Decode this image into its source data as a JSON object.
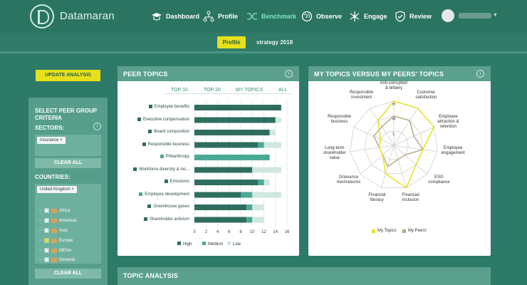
{
  "brand": "Datamaran",
  "nav": [
    {
      "label": "Dashboard",
      "icon": "mortarboard-icon"
    },
    {
      "label": "Profile",
      "icon": "network-icon"
    },
    {
      "label": "Benchmark",
      "icon": "shuffle-icon",
      "active": true
    },
    {
      "label": "Observe",
      "icon": "globe-icon"
    },
    {
      "label": "Engage",
      "icon": "asterisk-icon"
    },
    {
      "label": "Review",
      "icon": "shield-check-icon"
    }
  ],
  "subtabs": {
    "profile": "Profile",
    "strategy": "strategy 2018"
  },
  "left": {
    "update": "UPDATE ANALYSIS",
    "title": "SELECT PEER GROUP CRITERIA",
    "sectors_label": "SECTORS:",
    "sector_chip": "Insurance",
    "clear_all_1": "CLEAR ALL",
    "countries_label": "COUNTRIES:",
    "country_chip": "United Kingdom",
    "regions": [
      {
        "name": "Africa",
        "checked": false
      },
      {
        "name": "Americas",
        "checked": false
      },
      {
        "name": "Asia",
        "checked": false
      },
      {
        "name": "Europe",
        "checked": true
      },
      {
        "name": "MENA",
        "checked": false
      },
      {
        "name": "Oceania",
        "checked": false
      }
    ],
    "clear_all_2": "CLEAR ALL",
    "chip_close": "×",
    "info": "i"
  },
  "peer_topics": {
    "title": "PEER TOPICS",
    "tabs": [
      "TOP 10",
      "TOP 20",
      "MY TOPICS",
      "ALL"
    ],
    "legend": [
      "High",
      "Medium",
      "Low"
    ],
    "colors": {
      "high": "#2e6e5e",
      "medium": "#4aa896",
      "low": "#cfe7df"
    }
  },
  "radar": {
    "title": "MY TOPICS VERSUS MY PEERS' TOPICS",
    "labels": [
      "Anti-corruption & bribery",
      "Customer satisfaction",
      "Employee attraction & retention",
      "Employee engagement",
      "ESG compliance",
      "Financial inclusion",
      "Financial literacy",
      "Grievance mechanisms",
      "Long-term shareholder value",
      "Responsible business",
      "Responsible investment"
    ],
    "levels": [
      "H",
      "M",
      "L"
    ],
    "my_topics": [
      3,
      3,
      3,
      2,
      2,
      3,
      2,
      1,
      1,
      1,
      2
    ],
    "peers": [
      2,
      2,
      1.5,
      2,
      1,
      1,
      1.5,
      1,
      1,
      1.5,
      1.5
    ],
    "legend": [
      "My Topics",
      "My Peers'"
    ],
    "colors": {
      "mine": "#e6e21c",
      "peers": "#b9ab86"
    }
  },
  "topic_analysis": {
    "title": "TOPIC ANALYSIS"
  },
  "chart_data": {
    "type": "bar",
    "categories": [
      "Employee benefits",
      "Executive compensation",
      "Board composition",
      "Responsible business",
      "Philanthropy",
      "Workforce diversity & inc...",
      "Emissions",
      "Employee development",
      "Greenhouse gases",
      "Shareholder activism"
    ],
    "category_colors": [
      "#2e6e5e",
      "#2e6e5e",
      "#2e6e5e",
      "#2e6e5e",
      "#4aa896",
      "#2e6e5e",
      "#2e6e5e",
      "#4aa896",
      "#2e6e5e",
      "#2e6e5e"
    ],
    "series": [
      {
        "name": "High",
        "values": [
          15,
          14,
          13,
          11,
          0,
          10,
          11,
          8,
          9,
          9
        ]
      },
      {
        "name": "Medium",
        "values": [
          0,
          0,
          0,
          1,
          13,
          0,
          1,
          2,
          1,
          1
        ]
      },
      {
        "name": "Low",
        "values": [
          0,
          1,
          1,
          3,
          0,
          5,
          1,
          5,
          2,
          2
        ]
      }
    ],
    "xlim": [
      0,
      16
    ],
    "xticks": [
      0,
      2,
      4,
      6,
      8,
      10,
      12,
      14,
      16
    ],
    "grid": true,
    "legend": "bottom"
  }
}
